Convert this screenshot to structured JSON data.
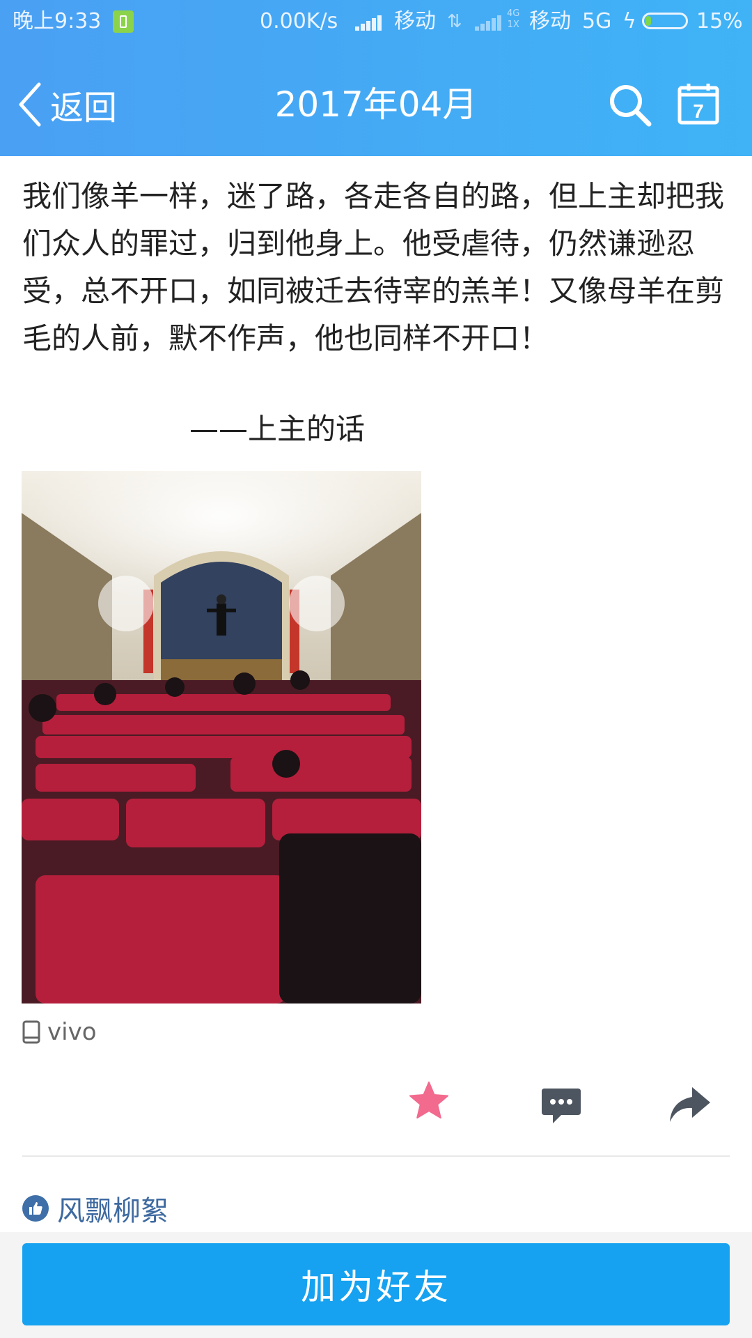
{
  "status_bar": {
    "time": "晚上9:33",
    "net_speed": "0.00K/s",
    "carrier1": "移动",
    "net_small_top": "4G",
    "net_small_bottom": "1X",
    "carrier2": "移动",
    "network": "5G",
    "battery_percent": "15%",
    "battery_level": 0.15
  },
  "nav": {
    "back_label": "返回",
    "title": "2017年04月",
    "calendar_day": "7"
  },
  "post": {
    "text": "我们像羊一样，迷了路，各走各自的路，但上主却把我们众人的罪过，归到他身上。他受虐待，仍然谦逊忍受，总不开口，如同被迁去待宰的羔羊！又像母羊在剪毛的人前，默不作声，他也同样不开口！",
    "signature": "——上主的话",
    "device": "vivo"
  },
  "likes": {
    "names": "风飘柳絮"
  },
  "footer": {
    "add_friend_label": "加为好友"
  },
  "colors": {
    "header_start": "#4aa0f3",
    "header_end": "#3fb3f6",
    "like_star": "#f26a8d",
    "button": "#16a2f0",
    "liker_name": "#3e6aa0"
  }
}
